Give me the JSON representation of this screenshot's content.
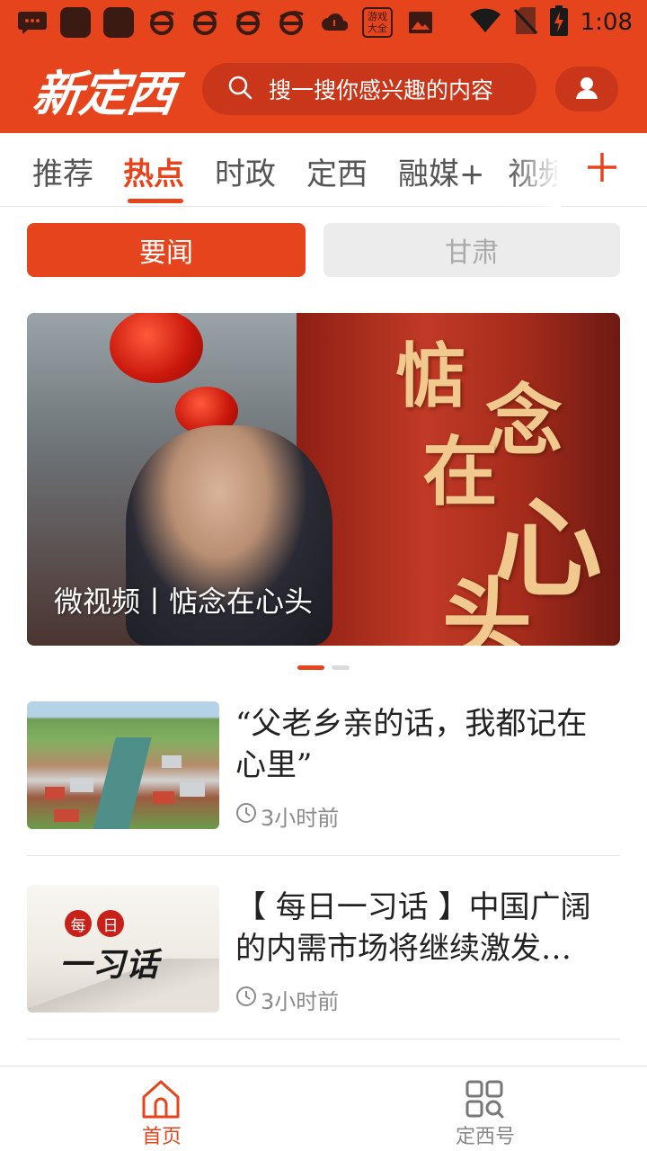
{
  "status_bar": {
    "time": "1:08",
    "icons": [
      "message-icon",
      "app-icon",
      "app-icon",
      "browser-icon",
      "browser-icon",
      "browser-icon",
      "browser-icon",
      "cloud-icon",
      "game-center-icon",
      "image-icon",
      "wifi-icon",
      "no-sim-icon",
      "battery-charging-icon"
    ],
    "game_badge": "游戏大全"
  },
  "header": {
    "logo_text": "新定西",
    "search_placeholder": "搜一搜你感兴趣的内容",
    "accent_color": "#e5441d"
  },
  "channel_tabs": {
    "items": [
      {
        "label": "推荐",
        "active": false
      },
      {
        "label": "热点",
        "active": true
      },
      {
        "label": "时政",
        "active": false
      },
      {
        "label": "定西",
        "active": false
      },
      {
        "label": "融媒+",
        "active": false
      },
      {
        "label": "视频",
        "active": false
      }
    ],
    "add_icon": "plus-icon"
  },
  "sub_tabs": {
    "items": [
      {
        "label": "要闻",
        "active": true
      },
      {
        "label": "甘肃",
        "active": false
      }
    ]
  },
  "banner": {
    "caption": "微视频丨惦念在心头",
    "calligraphy": [
      "惦",
      "念",
      "在",
      "心",
      "头"
    ],
    "page_count": 2,
    "current_page": 1
  },
  "news": [
    {
      "title": "“父老乡亲的话，我都记在心里”",
      "time": "3小时前",
      "thumb": "village-aerial"
    },
    {
      "title": "【 每日一习话 】中国广阔的内需市场将继续激发…",
      "time": "3小时前",
      "thumb": "daily-xi-quote",
      "thumb_text": {
        "seal_1": "每",
        "seal_2": "日",
        "brush": "一习话"
      }
    }
  ],
  "bottom_nav": {
    "items": [
      {
        "label": "首页",
        "icon": "home-icon",
        "active": true
      },
      {
        "label": "定西号",
        "icon": "grid-search-icon",
        "active": false
      }
    ]
  }
}
